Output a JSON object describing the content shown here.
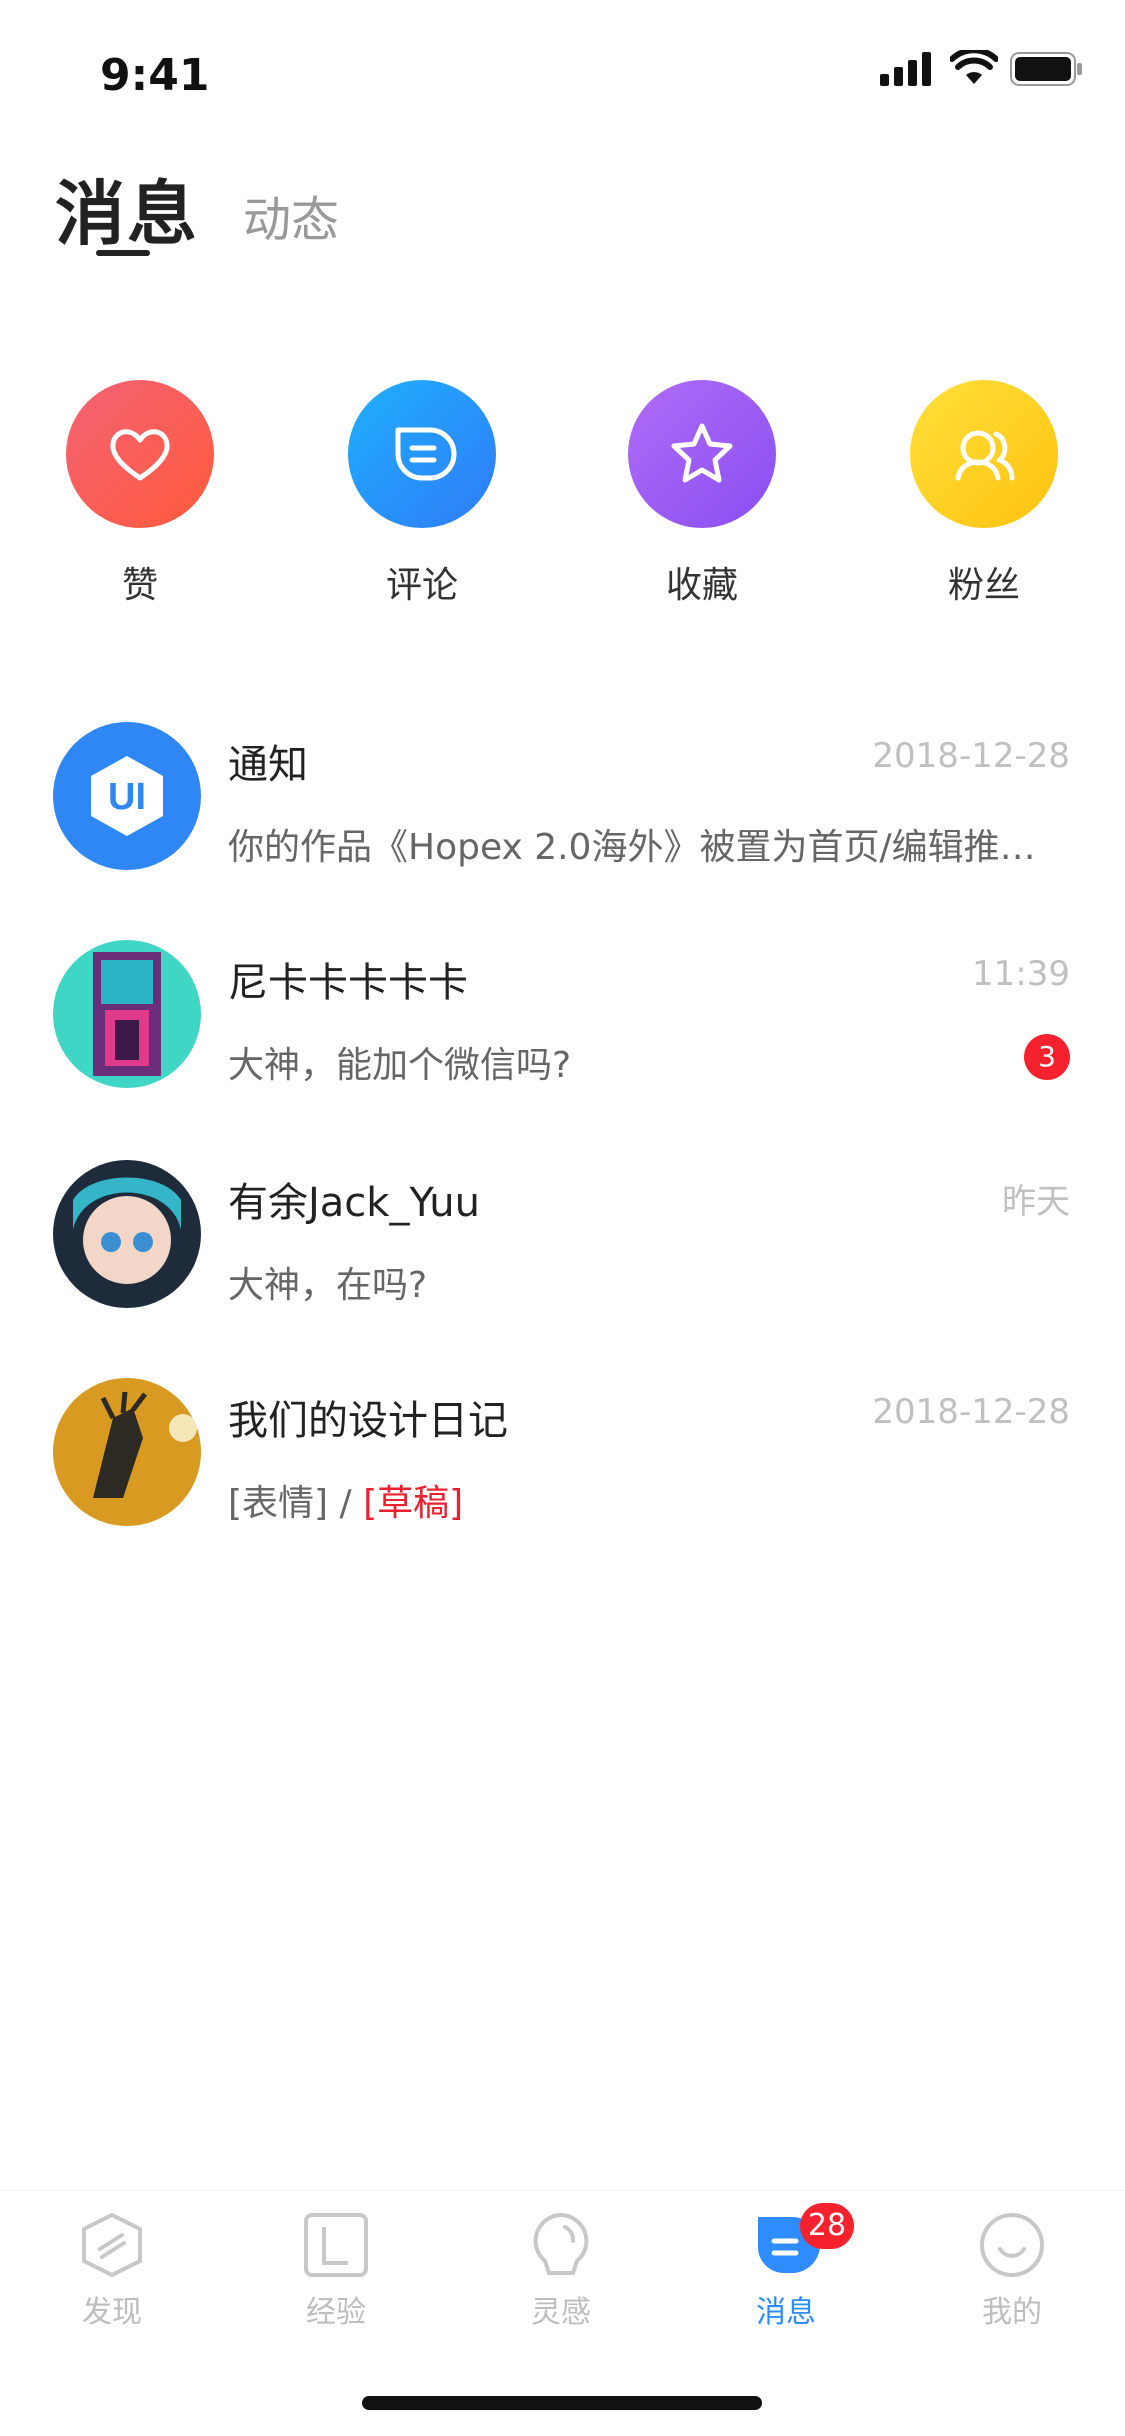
{
  "status_bar": {
    "time": "9:41"
  },
  "header": {
    "active_tab": "消息",
    "inactive_tab": "动态"
  },
  "shortcuts": [
    {
      "label": "赞",
      "icon": "heart-icon",
      "color": "#f5474d"
    },
    {
      "label": "评论",
      "icon": "comment-icon",
      "color": "#1e90ff"
    },
    {
      "label": "收藏",
      "icon": "star-icon",
      "color": "#9b59f0"
    },
    {
      "label": "粉丝",
      "icon": "fans-icon",
      "color": "#ffc21a"
    }
  ],
  "conversations": [
    {
      "name": "通知",
      "time": "2018-12-28",
      "preview": "你的作品《Hopex 2.0海外》被置为首页/编辑推荐..."
    },
    {
      "name": "尼卡卡卡卡卡",
      "time": "11:39",
      "preview": "大神，能加个微信吗?",
      "unread": "3"
    },
    {
      "name": "有余Jack_Yuu",
      "time": "昨天",
      "preview": "大神，在吗?"
    },
    {
      "name": "我们的设计日记",
      "time": "2018-12-28",
      "preview_prefix": "[表情] / ",
      "preview_draft": "[草稿]"
    }
  ],
  "notification_logo_text": "UI",
  "tabbar": {
    "items": [
      {
        "label": "发现",
        "icon": "discover-icon"
      },
      {
        "label": "经验",
        "icon": "experience-icon"
      },
      {
        "label": "灵感",
        "icon": "inspiration-icon"
      },
      {
        "label": "消息",
        "icon": "message-icon",
        "badge": "28",
        "active": true
      },
      {
        "label": "我的",
        "icon": "profile-icon"
      }
    ],
    "active_color": "#2f8cff",
    "inactive_color": "#bdbdbd"
  }
}
